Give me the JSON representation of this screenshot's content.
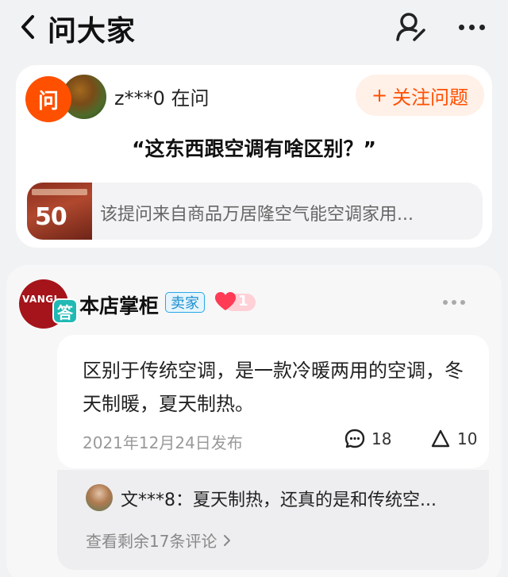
{
  "header": {
    "title": "问大家",
    "back_icon": "chevron-left-icon",
    "profile_icon": "user-edit-icon",
    "more_icon": "more-dots-icon"
  },
  "question": {
    "ask_badge": "问",
    "asker": "z***0 在问",
    "follow_label": "关注问题",
    "follow_plus": "+",
    "text": "“这东西跟空调有啥区别？”",
    "source_thumb_text": "50",
    "source_text": "该提问来自商品万居隆空气能空调家用..."
  },
  "answer": {
    "shop_logo": "VANGL",
    "answer_badge": "答",
    "shop_name": "本店掌柜",
    "seller_tag": "卖家",
    "heart_count": "1",
    "text": "区别于传统空调，是一款冷暖两用的空调，冬天制暖，夏天制热。",
    "date": "2021年12月24日发布",
    "comment_count": "18",
    "like_count": "10"
  },
  "comments": {
    "preview": "文***8：夏天制热，还真的是和传统空...",
    "view_more": "查看剩余17条评论"
  },
  "colors": {
    "accent": "#ff5000",
    "answer_badge": "#21b9b4",
    "seller_blue": "#1c8fd0"
  }
}
